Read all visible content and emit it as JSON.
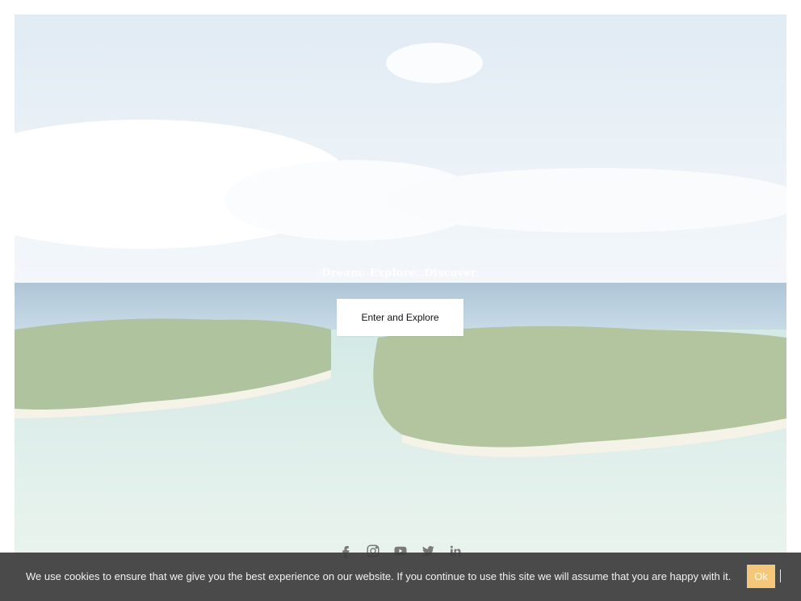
{
  "hero": {
    "tagline": "Dream. Explore. Discover.",
    "cta_label": "Enter and Explore"
  },
  "social": {
    "icons": [
      "facebook-icon",
      "instagram-icon",
      "youtube-icon",
      "twitter-icon",
      "linkedin-icon"
    ],
    "icon_color": "#7a7a7a"
  },
  "cookie_bar": {
    "message": "We use cookies to ensure that we give you the best experience on our website. If you continue to use this site we will assume that you are happy with it.",
    "ok_label": "Ok",
    "background": "#3c3c3c",
    "button_color": "#f4c77a"
  }
}
